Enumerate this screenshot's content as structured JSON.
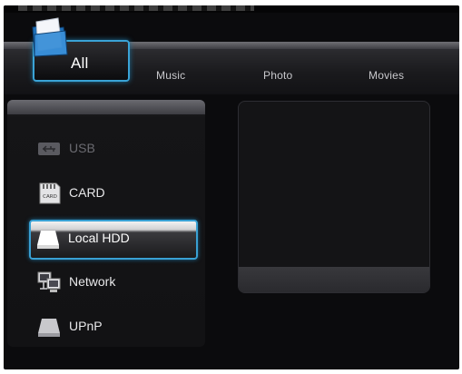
{
  "tabs": [
    {
      "label": "All",
      "selected": true
    },
    {
      "label": "Music",
      "selected": false
    },
    {
      "label": "Photo",
      "selected": false
    },
    {
      "label": "Movies",
      "selected": false
    }
  ],
  "devices": [
    {
      "label": "USB",
      "icon": "usb-icon",
      "enabled": false
    },
    {
      "label": "CARD",
      "icon": "sd-card-icon",
      "enabled": true,
      "icon_text": "CARD"
    },
    {
      "label": "Local HDD",
      "icon": "hard-drive-icon",
      "enabled": true,
      "selected": true
    },
    {
      "label": "Network",
      "icon": "network-computers-icon",
      "enabled": true
    },
    {
      "label": "UPnP",
      "icon": "upnp-icon",
      "enabled": true
    }
  ],
  "colors": {
    "accent": "#3aa3d6",
    "background": "#0b0b0d",
    "text": "#e8e8ea"
  }
}
